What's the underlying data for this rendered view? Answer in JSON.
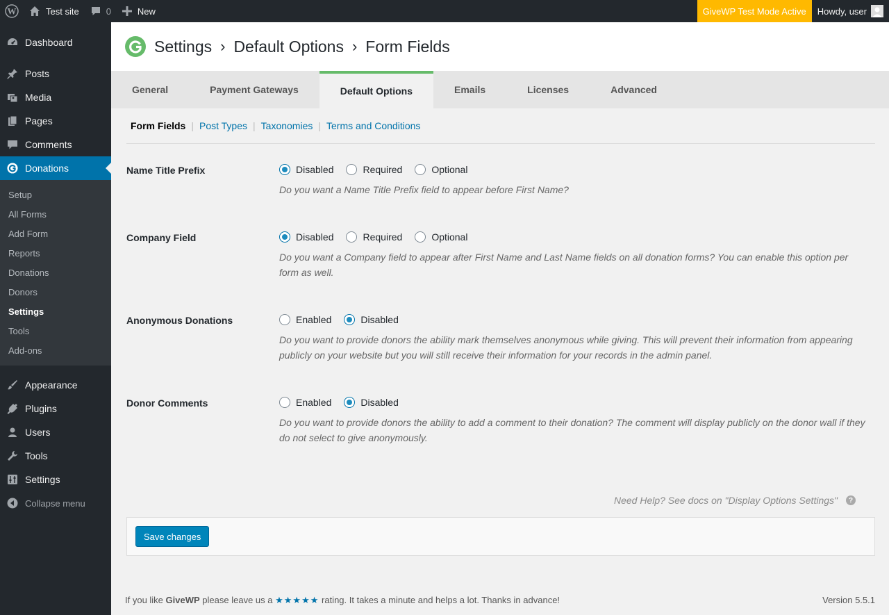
{
  "adminbar": {
    "site_name": "Test site",
    "comments_count": "0",
    "new_label": "New",
    "test_mode": "GiveWP Test Mode Active",
    "howdy": "Howdy, user"
  },
  "sidebar": {
    "items": [
      {
        "label": "Dashboard",
        "icon": "dashboard-icon"
      },
      {
        "label": "Posts",
        "icon": "pushpin-icon"
      },
      {
        "label": "Media",
        "icon": "media-icon"
      },
      {
        "label": "Pages",
        "icon": "pages-icon"
      },
      {
        "label": "Comments",
        "icon": "comment-icon"
      },
      {
        "label": "Donations",
        "icon": "give-icon"
      }
    ],
    "submenu": [
      "Setup",
      "All Forms",
      "Add Form",
      "Reports",
      "Donations",
      "Donors",
      "Settings",
      "Tools",
      "Add-ons"
    ],
    "items_after": [
      {
        "label": "Appearance",
        "icon": "brush-icon"
      },
      {
        "label": "Plugins",
        "icon": "plugin-icon"
      },
      {
        "label": "Users",
        "icon": "users-icon"
      },
      {
        "label": "Tools",
        "icon": "wrench-icon"
      },
      {
        "label": "Settings",
        "icon": "settings-icon"
      }
    ],
    "collapse_label": "Collapse menu"
  },
  "header": {
    "crumbs": [
      "Settings",
      "Default Options",
      "Form Fields"
    ],
    "separator": "›"
  },
  "tabs": [
    "General",
    "Payment Gateways",
    "Default Options",
    "Emails",
    "Licenses",
    "Advanced"
  ],
  "subnav": [
    "Form Fields",
    "Post Types",
    "Taxonomies",
    "Terms and Conditions"
  ],
  "fields": [
    {
      "label": "Name Title Prefix",
      "options": [
        "Disabled",
        "Required",
        "Optional"
      ],
      "selected": "Disabled",
      "description": "Do you want a Name Title Prefix field to appear before First Name?"
    },
    {
      "label": "Company Field",
      "options": [
        "Disabled",
        "Required",
        "Optional"
      ],
      "selected": "Disabled",
      "description": "Do you want a Company field to appear after First Name and Last Name fields on all donation forms? You can enable this option per form as well."
    },
    {
      "label": "Anonymous Donations",
      "options": [
        "Enabled",
        "Disabled"
      ],
      "selected": "Disabled",
      "description": "Do you want to provide donors the ability mark themselves anonymous while giving. This will prevent their information from appearing publicly on your website but you will still receive their information for your records in the admin panel."
    },
    {
      "label": "Donor Comments",
      "options": [
        "Enabled",
        "Disabled"
      ],
      "selected": "Disabled",
      "description": "Do you want to provide donors the ability to add a comment to their donation? The comment will display publicly on the donor wall if they do not select to give anonymously."
    }
  ],
  "help_text": "Need Help? See docs on \"Display Options Settings\"",
  "help_icon": "?",
  "save_label": "Save changes",
  "footer": {
    "prefix": "If you like",
    "brand": "GiveWP",
    "middle": "please leave us a",
    "stars": "★★★★★",
    "suffix": "rating. It takes a minute and helps a lot. Thanks in advance!",
    "version": "Version 5.5.1"
  },
  "colors": {
    "accent": "#0073aa",
    "test_mode": "#ffb900",
    "tab_active_border": "#66bb6a",
    "logo": "#66bb6a"
  }
}
